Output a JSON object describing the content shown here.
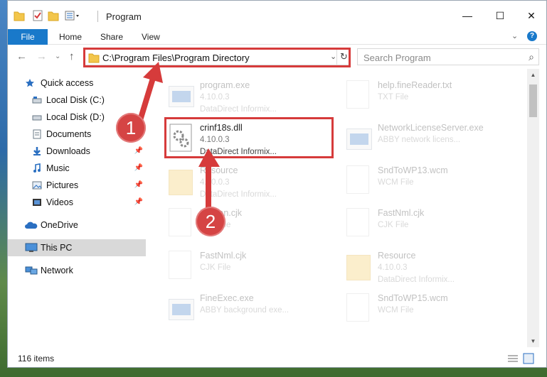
{
  "window": {
    "title": "Program",
    "minimize_glyph": "—",
    "maximize_glyph": "☐",
    "close_glyph": "✕"
  },
  "ribbon": {
    "tabs": [
      "File",
      "Home",
      "Share",
      "View"
    ],
    "expand_glyph": "⌄",
    "help_glyph": "?"
  },
  "nav": {
    "back": "←",
    "forward": "→",
    "dropdown": "⌄",
    "up": "↑",
    "address": "C:\\Program Files\\Program Directory",
    "address_dropdown": "⌄",
    "refresh": "↻",
    "search_placeholder": "Search Program",
    "search_icon": "⌕"
  },
  "sidebar": {
    "items": [
      {
        "label": "Quick access",
        "icon": "star-icon"
      },
      {
        "label": "Local Disk (C:)",
        "icon": "drive-icon"
      },
      {
        "label": "Local Disk (D:)",
        "icon": "drive-icon"
      },
      {
        "label": "Documents",
        "icon": "documents-icon"
      },
      {
        "label": "Downloads",
        "icon": "download-icon",
        "pinned": true
      },
      {
        "label": "Music",
        "icon": "music-icon",
        "pinned": true
      },
      {
        "label": "Pictures",
        "icon": "pictures-icon",
        "pinned": true
      },
      {
        "label": "Videos",
        "icon": "videos-icon",
        "pinned": true
      },
      {
        "label": "OneDrive",
        "icon": "cloud-icon"
      },
      {
        "label": "This PC",
        "icon": "pc-icon",
        "selected": true
      },
      {
        "label": "Network",
        "icon": "network-icon"
      }
    ],
    "pin_glyph": "📌"
  },
  "files": {
    "left": [
      {
        "name": "program.exe",
        "line2": "4.10.0.3",
        "line3": "DataDirect Informix...",
        "type": "exe"
      },
      {
        "name": "crinf18s.dll",
        "line2": "4.10.0.3",
        "line3": "DataDirect Informix...",
        "type": "dll"
      },
      {
        "name": "Resource",
        "line2": "4.10.0.3",
        "line3": "DataDirect Informix...",
        "type": "folder"
      },
      {
        "name": "Korean.cjk",
        "line2": "CJK File",
        "line3": "",
        "type": "doc"
      },
      {
        "name": "FastNml.cjk",
        "line2": "CJK File",
        "line3": "",
        "type": "doc"
      },
      {
        "name": "FineExec.exe",
        "line2": "ABBY background exe...",
        "line3": "",
        "type": "exe"
      }
    ],
    "right": [
      {
        "name": "help.fineReader.txt",
        "line2": "TXT File",
        "line3": "",
        "type": "doc"
      },
      {
        "name": "NetworkLicenseServer.exe",
        "line2": "ABBY network licens...",
        "line3": "",
        "type": "exe"
      },
      {
        "name": "SndToWP13.wcm",
        "line2": "WCM File",
        "line3": "",
        "type": "doc"
      },
      {
        "name": "FastNml.cjk",
        "line2": "CJK File",
        "line3": "",
        "type": "doc"
      },
      {
        "name": "Resource",
        "line2": "4.10.0.3",
        "line3": "DataDirect Informix...",
        "type": "folder"
      },
      {
        "name": "SndToWP15.wcm",
        "line2": "WCM File",
        "line3": "",
        "type": "doc"
      }
    ]
  },
  "status": {
    "item_count": "116 items"
  },
  "annotations": {
    "step1": "1",
    "step2": "2",
    "accent_color": "#d63b3b"
  },
  "colors": {
    "file_tab": "#1979ca",
    "selected_nav": "#d9d9d9"
  }
}
